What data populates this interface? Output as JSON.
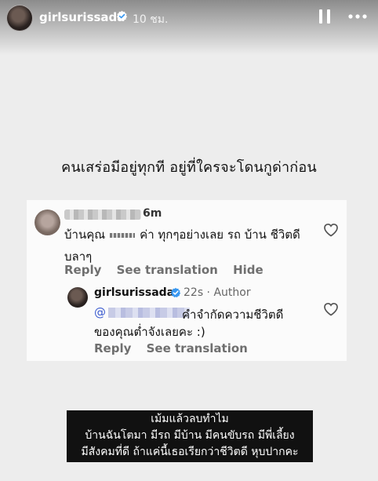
{
  "header": {
    "username": "girlsurissada",
    "time": "10 ชม."
  },
  "caption": "คนเสร่อมีอยู่ทุกที   อยู่ที่ใครจะโดนกูด่าก่อน",
  "comment": {
    "age": "6m",
    "text_start": "บ้านคุณ",
    "text_rest": "ค่า ทุกๆอย่างเลย รถ บ้าน ชีวิตดี",
    "text_line2": "บลาๆ",
    "actions": {
      "reply": "Reply",
      "translate": "See translation",
      "hide": "Hide"
    }
  },
  "reply": {
    "username": "girlsurissada",
    "meta": "22s · Author",
    "mention_prefix": "@",
    "text_line1": "คำจำกัดความชีวิตดี",
    "text_line2": "ของคุณต่ำจังเลยคะ :)",
    "actions": {
      "reply": "Reply",
      "translate": "See translation"
    }
  },
  "bottom_caption": {
    "line1": "เม้มแล้วลบทำไม",
    "line2": "บ้านฉันโตมา  มีรถ  มีบ้าน  มีคนขับรถ  มีพี่เลี้ยง",
    "line3": "มีสังคมที่ดี  ถ้าแค่นี้เธอเรียกว่าชีวิตดี  หุบปากคะ"
  },
  "colors": {
    "verified": "#3897f0",
    "mention": "#3b5bcf",
    "action_grey": "#6f6f6f",
    "background": "#ededed"
  },
  "icons": [
    "pause-icon",
    "more-options-icon",
    "verified-badge-icon",
    "heart-outline-icon"
  ]
}
